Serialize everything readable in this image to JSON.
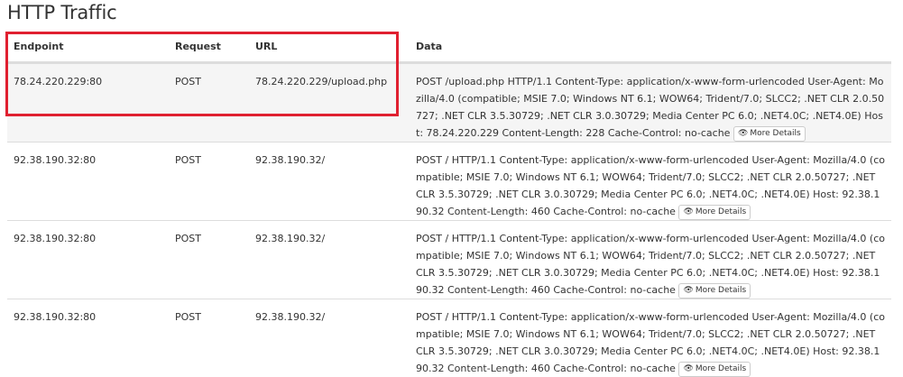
{
  "page": {
    "title": "HTTP Traffic"
  },
  "table": {
    "headers": {
      "endpoint": "Endpoint",
      "request": "Request",
      "url": "URL",
      "data": "Data"
    },
    "more_label": "More Details",
    "rows": [
      {
        "endpoint": "78.24.220.229:80",
        "request": "POST",
        "url": "78.24.220.229/upload.php",
        "data": "POST /upload.php HTTP/1.1 Content-Type: application/x-www-form-urlencoded User-Agent: Mozilla/4.0 (compatible; MSIE 7.0; Windows NT 6.1; WOW64; Trident/7.0; SLCC2; .NET CLR 2.0.50727; .NET CLR 3.5.30729; .NET CLR 3.0.30729; Media Center PC 6.0; .NET4.0C; .NET4.0E) Host: 78.24.220.229 Content-Length: 228 Cache-Control: no-cache"
      },
      {
        "endpoint": "92.38.190.32:80",
        "request": "POST",
        "url": "92.38.190.32/",
        "data": "POST / HTTP/1.1 Content-Type: application/x-www-form-urlencoded User-Agent: Mozilla/4.0 (compatible; MSIE 7.0; Windows NT 6.1; WOW64; Trident/7.0; SLCC2; .NET CLR 2.0.50727; .NET CLR 3.5.30729; .NET CLR 3.0.30729; Media Center PC 6.0; .NET4.0C; .NET4.0E) Host: 92.38.190.32 Content-Length: 460 Cache-Control: no-cache"
      },
      {
        "endpoint": "92.38.190.32:80",
        "request": "POST",
        "url": "92.38.190.32/",
        "data": "POST / HTTP/1.1 Content-Type: application/x-www-form-urlencoded User-Agent: Mozilla/4.0 (compatible; MSIE 7.0; Windows NT 6.1; WOW64; Trident/7.0; SLCC2; .NET CLR 2.0.50727; .NET CLR 3.5.30729; .NET CLR 3.0.30729; Media Center PC 6.0; .NET4.0C; .NET4.0E) Host: 92.38.190.32 Content-Length: 460 Cache-Control: no-cache"
      },
      {
        "endpoint": "92.38.190.32:80",
        "request": "POST",
        "url": "92.38.190.32/",
        "data": "POST / HTTP/1.1 Content-Type: application/x-www-form-urlencoded User-Agent: Mozilla/4.0 (compatible; MSIE 7.0; Windows NT 6.1; WOW64; Trident/7.0; SLCC2; .NET CLR 2.0.50727; .NET CLR 3.5.30729; .NET CLR 3.0.30729; Media Center PC 6.0; .NET4.0C; .NET4.0E) Host: 92.38.190.32 Content-Length: 460 Cache-Control: no-cache"
      }
    ]
  },
  "colors": {
    "highlight": "#e02030",
    "row_shade": "#f5f5f5",
    "border": "#dddddd"
  },
  "icons": {
    "more": "eye-icon"
  }
}
